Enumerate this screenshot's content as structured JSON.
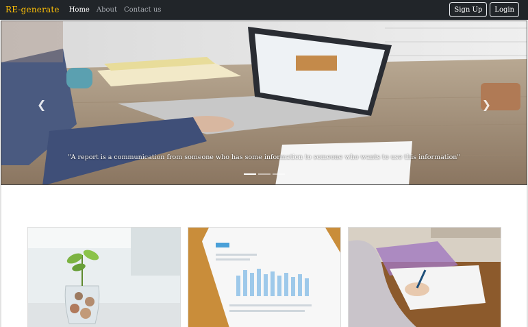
{
  "nav": {
    "brand": "RE-generate",
    "links": [
      "Home",
      "About",
      "Contact us"
    ],
    "signup_label": "Sign Up",
    "login_label": "Login"
  },
  "carousel": {
    "caption": "\"A report is a communication from someone who has some information to someone who wants to use this information\"",
    "prev_icon": "chevron-left-icon",
    "next_icon": "chevron-right-icon",
    "slide_count": 3,
    "active_slide": 1
  },
  "cards": [
    {
      "image": "plant-in-coin-jar"
    },
    {
      "image": "bar-chart-report-on-desk"
    },
    {
      "image": "person-writing"
    }
  ],
  "colors": {
    "brand": "#ffc107",
    "navbar": "#212529"
  }
}
